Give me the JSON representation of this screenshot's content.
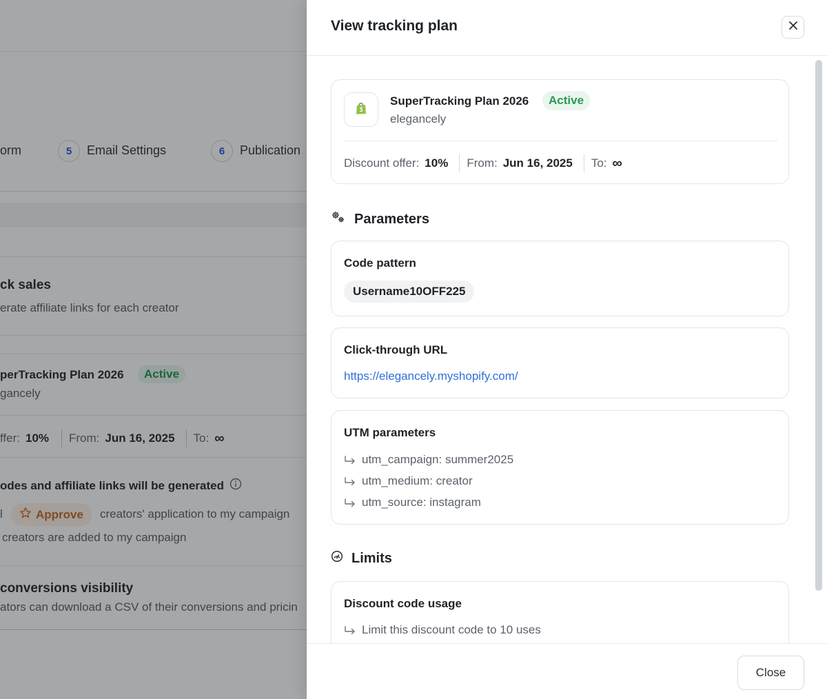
{
  "background": {
    "steps": [
      {
        "num": "",
        "label": "orm"
      },
      {
        "num": "5",
        "label": "Email Settings"
      },
      {
        "num": "6",
        "label": "Publication"
      }
    ],
    "track_sales": {
      "title": "ck sales",
      "subtitle": "erate affiliate links for each creator"
    },
    "plan": {
      "name": "perTracking Plan 2026",
      "status": "Active",
      "shop": "gancely",
      "discount_label": "ffer:",
      "discount_value": "10%",
      "from_label": "From:",
      "from_value": "Jun 16, 2025",
      "to_label": "To:",
      "to_value": "∞"
    },
    "generation": {
      "title": "odes and affiliate links will be generated",
      "prefix": "l",
      "approve_label": "Approve",
      "approve_suffix": "creators' application to my campaign",
      "line2": "creators are added to my campaign"
    },
    "visibility": {
      "title": "conversions visibility",
      "subtitle": "ators can download a CSV of their conversions and pricin"
    }
  },
  "drawer": {
    "title": "View tracking plan",
    "plan": {
      "name": "SuperTracking Plan 2026",
      "status": "Active",
      "shop": "elegancely",
      "discount_label": "Discount offer:",
      "discount_value": "10%",
      "from_label": "From:",
      "from_value": "Jun 16, 2025",
      "to_label": "To:",
      "to_value": "∞"
    },
    "parameters": {
      "heading": "Parameters",
      "code_pattern": {
        "title": "Code pattern",
        "value": "Username10OFF225"
      },
      "click_through": {
        "title": "Click-through URL",
        "url": "https://elegancely.myshopify.com/"
      },
      "utm": {
        "title": "UTM parameters",
        "items": [
          "utm_campaign: summer2025",
          "utm_medium: creator",
          "utm_source: instagram"
        ]
      }
    },
    "limits": {
      "heading": "Limits",
      "discount_usage": {
        "title": "Discount code usage",
        "text": "Limit this discount code to 10 uses"
      }
    },
    "footer": {
      "close_label": "Close"
    }
  },
  "icons": {
    "close": "close-icon",
    "shopify": "shopify-bag-icon",
    "parameters": "gears-icon",
    "limits": "gauge-icon",
    "sub_arrow": "return-arrow-icon",
    "info": "info-icon",
    "star": "star-icon"
  },
  "colors": {
    "accent_link": "#2f6fdb",
    "active_green": "#2a9a55",
    "approve_orange": "#c2651d",
    "step_blue": "#2b4dd6"
  }
}
